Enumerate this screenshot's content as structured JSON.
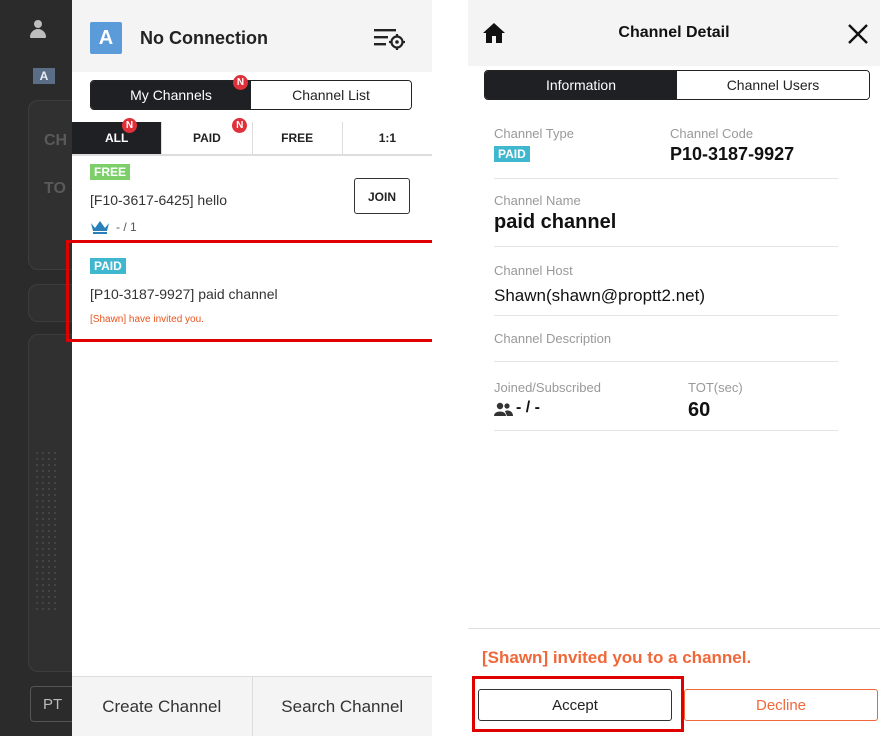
{
  "left_screen": {
    "background": {
      "badge_label": "A",
      "text_ch": "CH",
      "text_to": "TO",
      "ptt_label": "PT"
    },
    "header": {
      "avatar_letter": "A",
      "title": "No Connection",
      "settings_icon": "list-settings-icon"
    },
    "segmented": {
      "my_channels": "My Channels",
      "channel_list": "Channel List",
      "my_channels_badge": "N"
    },
    "filter_tabs": [
      {
        "label": "ALL",
        "badge": "N",
        "active": true
      },
      {
        "label": "PAID",
        "badge": "N",
        "active": false
      },
      {
        "label": "FREE",
        "badge": "",
        "active": false
      },
      {
        "label": "1:1",
        "badge": "",
        "active": false
      }
    ],
    "channels": [
      {
        "tag": "FREE",
        "name": "[F10-3617-6425] hello",
        "users": "- / 1",
        "action": "JOIN"
      },
      {
        "tag": "PAID",
        "name": "[P10-3187-9927] paid channel",
        "invite_note": "[Shawn] have invited you."
      }
    ],
    "bottom": {
      "create": "Create Channel",
      "search": "Search Channel"
    }
  },
  "right_screen": {
    "header": {
      "title": "Channel Detail",
      "home_icon": "home-icon",
      "close_icon": "close-icon"
    },
    "tabs": {
      "information": "Information",
      "channel_users": "Channel Users"
    },
    "fields": {
      "channel_type_label": "Channel Type",
      "channel_type_value": "PAID",
      "channel_code_label": "Channel Code",
      "channel_code_value": "P10-3187-9927",
      "channel_name_label": "Channel Name",
      "channel_name_value": "paid channel",
      "channel_host_label": "Channel Host",
      "channel_host_value": "Shawn(shawn@proptt2.net)",
      "channel_description_label": "Channel Description",
      "joined_label": "Joined/Subscribed",
      "joined_value": "- / -",
      "tot_label": "TOT(sec)",
      "tot_value": "60"
    },
    "invite_message": "[Shawn] invited you to a channel.",
    "accept": "Accept",
    "decline": "Decline"
  },
  "colors": {
    "free_tag": "#7dcf6a",
    "paid_tag": "#3fb7cf",
    "badge": "#e0303a",
    "invite_orange": "#f0683a",
    "highlight": "#e00000",
    "dark": "#1e2024"
  }
}
